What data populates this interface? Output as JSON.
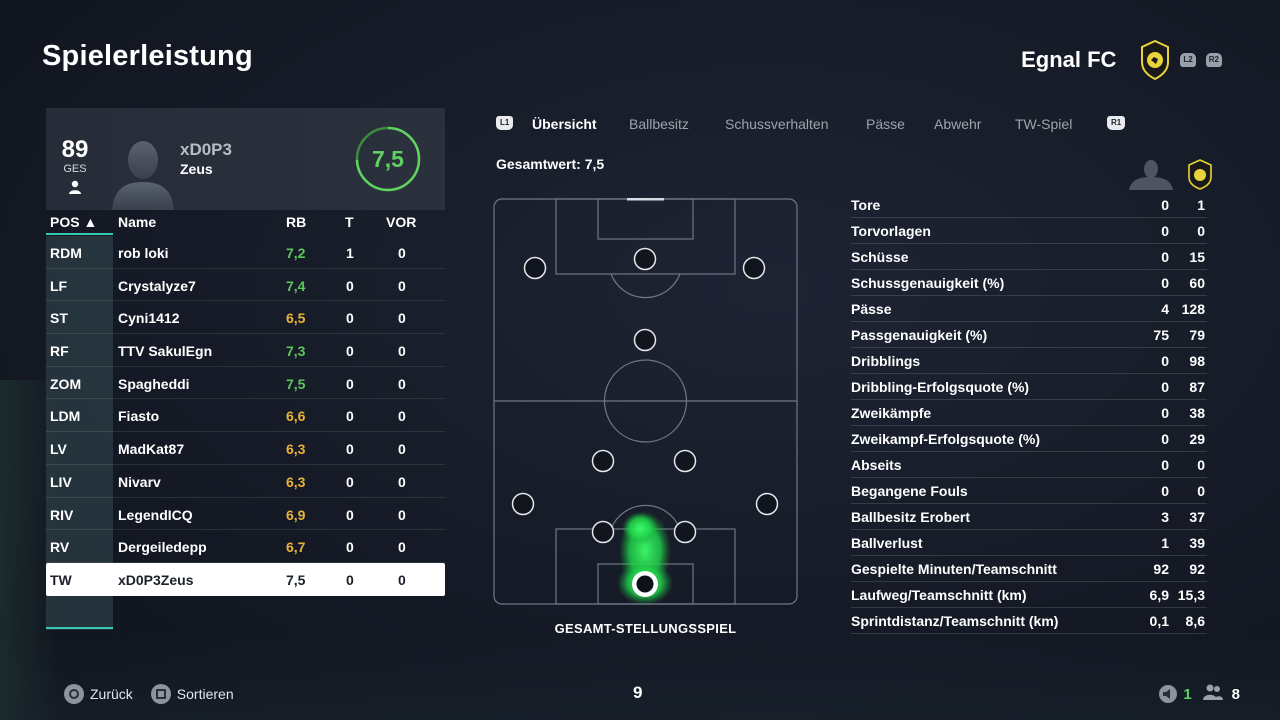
{
  "header": {
    "title": "Spielerleistung",
    "team_name": "Egnal FC",
    "hint_l2": "L2",
    "hint_r2": "R2"
  },
  "player_card": {
    "overall": "89",
    "overall_label": "GES",
    "gamertag": "xD0P3",
    "name": "Zeus",
    "rating": "7,5",
    "rating_value": 7.5
  },
  "table": {
    "headers": {
      "pos": "POS ▲",
      "name": "Name",
      "rb": "RB",
      "t": "T",
      "vor": "VOR"
    },
    "rows": [
      {
        "pos": "RDM",
        "name": "rob loki",
        "rb": "7,2",
        "t": "1",
        "vor": "0",
        "rb_color": "#5cc75c"
      },
      {
        "pos": "LF",
        "name": "Crystalyze7",
        "rb": "7,4",
        "t": "0",
        "vor": "0",
        "rb_color": "#5cc75c"
      },
      {
        "pos": "ST",
        "name": "Cyni1412",
        "rb": "6,5",
        "t": "0",
        "vor": "0",
        "rb_color": "#e8b33c"
      },
      {
        "pos": "RF",
        "name": "TTV SakulEgn",
        "rb": "7,3",
        "t": "0",
        "vor": "0",
        "rb_color": "#5cc75c"
      },
      {
        "pos": "ZOM",
        "name": "Spagheddi",
        "rb": "7,5",
        "t": "0",
        "vor": "0",
        "rb_color": "#5cc75c"
      },
      {
        "pos": "LDM",
        "name": "Fiasto",
        "rb": "6,6",
        "t": "0",
        "vor": "0",
        "rb_color": "#e8b33c"
      },
      {
        "pos": "LV",
        "name": "MadKat87",
        "rb": "6,3",
        "t": "0",
        "vor": "0",
        "rb_color": "#e8b33c"
      },
      {
        "pos": "LIV",
        "name": "Nivarv",
        "rb": "6,3",
        "t": "0",
        "vor": "0",
        "rb_color": "#e8b33c"
      },
      {
        "pos": "RIV",
        "name": "LegendICQ",
        "rb": "6,9",
        "t": "0",
        "vor": "0",
        "rb_color": "#e8b33c"
      },
      {
        "pos": "RV",
        "name": "Dergeiledepp",
        "rb": "6,7",
        "t": "0",
        "vor": "0",
        "rb_color": "#e8b33c"
      },
      {
        "pos": "TW",
        "name": "xD0P3Zeus",
        "rb": "7,5",
        "t": "0",
        "vor": "0",
        "rb_color": "#1c2029",
        "selected": true
      }
    ]
  },
  "tabs": {
    "left_bumper": "L1",
    "right_bumper": "R1",
    "items": [
      "Übersicht",
      "Ballbesitz",
      "Schussverhalten",
      "Pässe",
      "Abwehr",
      "TW-Spiel"
    ],
    "active_index": 0
  },
  "overview": {
    "gesamtwert": "Gesamtwert: 7,5",
    "pitch_caption": "GESAMT-STELLUNGSSPIEL"
  },
  "stats": [
    {
      "label": "Tore",
      "player": "0",
      "team": "1"
    },
    {
      "label": "Torvorlagen",
      "player": "0",
      "team": "0"
    },
    {
      "label": "Schüsse",
      "player": "0",
      "team": "15"
    },
    {
      "label": "Schussgenauigkeit (%)",
      "player": "0",
      "team": "60"
    },
    {
      "label": "Pässe",
      "player": "4",
      "team": "128"
    },
    {
      "label": "Passgenauigkeit (%)",
      "player": "75",
      "team": "79"
    },
    {
      "label": "Dribblings",
      "player": "0",
      "team": "98"
    },
    {
      "label": "Dribbling-Erfolgsquote (%)",
      "player": "0",
      "team": "87"
    },
    {
      "label": "Zweikämpfe",
      "player": "0",
      "team": "38"
    },
    {
      "label": "Zweikampf-Erfolgsquote (%)",
      "player": "0",
      "team": "29"
    },
    {
      "label": "Abseits",
      "player": "0",
      "team": "0"
    },
    {
      "label": "Begangene Fouls",
      "player": "0",
      "team": "0"
    },
    {
      "label": "Ballbesitz Erobert",
      "player": "3",
      "team": "37"
    },
    {
      "label": "Ballverlust",
      "player": "1",
      "team": "39"
    },
    {
      "label": "Gespielte Minuten/Teamschnitt",
      "player": "92",
      "team": "92"
    },
    {
      "label": "Laufweg/Teamschnitt (km)",
      "player": "6,9",
      "team": "15,3"
    },
    {
      "label": "Sprintdistanz/Teamschnitt (km)",
      "player": "0,1",
      "team": "8,6"
    }
  ],
  "footer": {
    "back_label": "Zurück",
    "sort_label": "Sortieren",
    "page_number": "9",
    "voice_count": "1",
    "party_count": "8"
  },
  "colors": {
    "accent_teal": "#34c9b0",
    "rating_green": "#5cc75c",
    "rating_amber": "#e8b33c",
    "heat_green": "#2ee85a"
  }
}
